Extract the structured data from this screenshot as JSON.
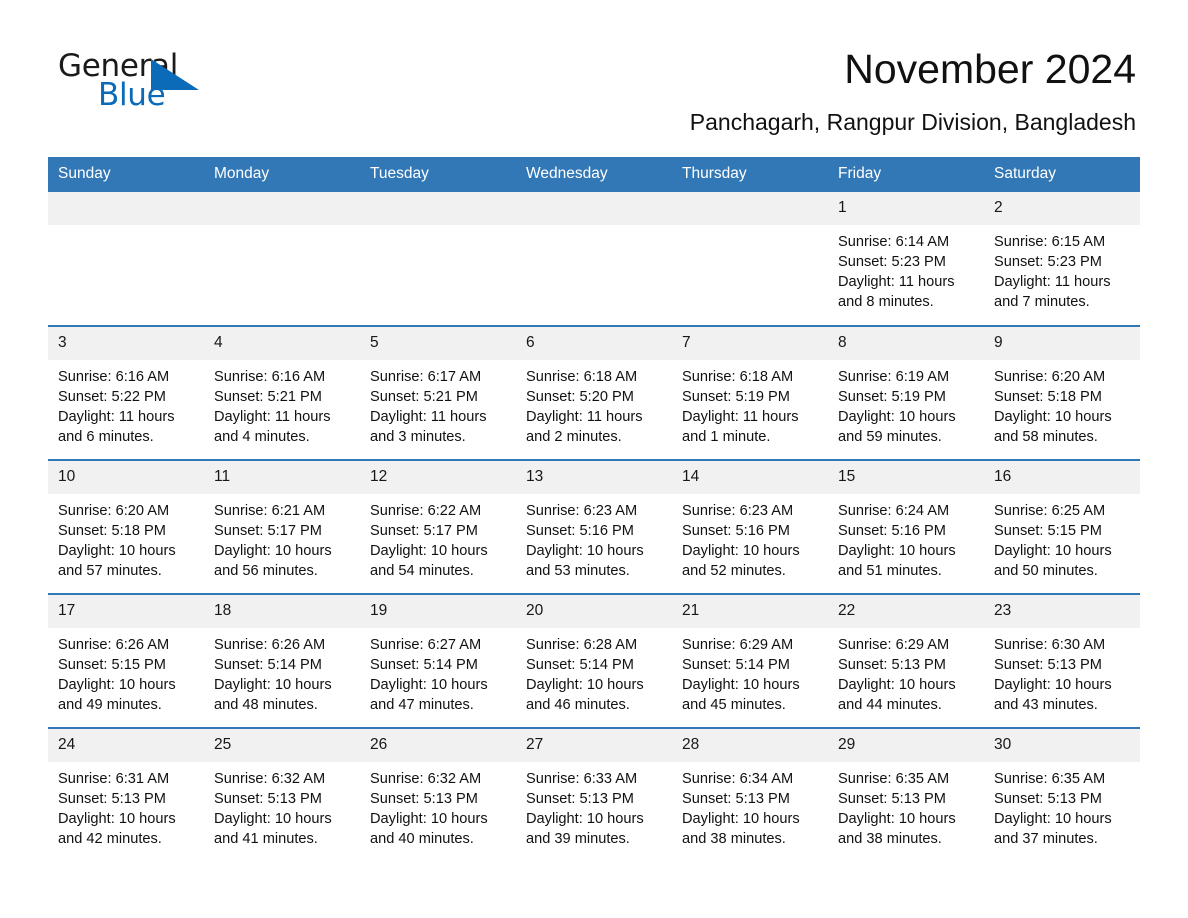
{
  "brand": {
    "word_one": "General",
    "word_two": "Blue",
    "flag_color": "#0b6bb8"
  },
  "header": {
    "month_title": "November 2024",
    "location": "Panchagarh, Rangpur Division, Bangladesh"
  },
  "theme": {
    "header_blue": "#3278b6",
    "daynum_gray": "#f1f1f1",
    "rule_blue": "#3278b6"
  },
  "calendar": {
    "weekday_headers": [
      "Sunday",
      "Monday",
      "Tuesday",
      "Wednesday",
      "Thursday",
      "Friday",
      "Saturday"
    ],
    "weeks": [
      [
        {
          "blank": true
        },
        {
          "blank": true
        },
        {
          "blank": true
        },
        {
          "blank": true
        },
        {
          "blank": true
        },
        {
          "day": "1",
          "sunrise": "Sunrise: 6:14 AM",
          "sunset": "Sunset: 5:23 PM",
          "daylight": "Daylight: 11 hours and 8 minutes."
        },
        {
          "day": "2",
          "sunrise": "Sunrise: 6:15 AM",
          "sunset": "Sunset: 5:23 PM",
          "daylight": "Daylight: 11 hours and 7 minutes."
        }
      ],
      [
        {
          "day": "3",
          "sunrise": "Sunrise: 6:16 AM",
          "sunset": "Sunset: 5:22 PM",
          "daylight": "Daylight: 11 hours and 6 minutes."
        },
        {
          "day": "4",
          "sunrise": "Sunrise: 6:16 AM",
          "sunset": "Sunset: 5:21 PM",
          "daylight": "Daylight: 11 hours and 4 minutes."
        },
        {
          "day": "5",
          "sunrise": "Sunrise: 6:17 AM",
          "sunset": "Sunset: 5:21 PM",
          "daylight": "Daylight: 11 hours and 3 minutes."
        },
        {
          "day": "6",
          "sunrise": "Sunrise: 6:18 AM",
          "sunset": "Sunset: 5:20 PM",
          "daylight": "Daylight: 11 hours and 2 minutes."
        },
        {
          "day": "7",
          "sunrise": "Sunrise: 6:18 AM",
          "sunset": "Sunset: 5:19 PM",
          "daylight": "Daylight: 11 hours and 1 minute."
        },
        {
          "day": "8",
          "sunrise": "Sunrise: 6:19 AM",
          "sunset": "Sunset: 5:19 PM",
          "daylight": "Daylight: 10 hours and 59 minutes."
        },
        {
          "day": "9",
          "sunrise": "Sunrise: 6:20 AM",
          "sunset": "Sunset: 5:18 PM",
          "daylight": "Daylight: 10 hours and 58 minutes."
        }
      ],
      [
        {
          "day": "10",
          "sunrise": "Sunrise: 6:20 AM",
          "sunset": "Sunset: 5:18 PM",
          "daylight": "Daylight: 10 hours and 57 minutes."
        },
        {
          "day": "11",
          "sunrise": "Sunrise: 6:21 AM",
          "sunset": "Sunset: 5:17 PM",
          "daylight": "Daylight: 10 hours and 56 minutes."
        },
        {
          "day": "12",
          "sunrise": "Sunrise: 6:22 AM",
          "sunset": "Sunset: 5:17 PM",
          "daylight": "Daylight: 10 hours and 54 minutes."
        },
        {
          "day": "13",
          "sunrise": "Sunrise: 6:23 AM",
          "sunset": "Sunset: 5:16 PM",
          "daylight": "Daylight: 10 hours and 53 minutes."
        },
        {
          "day": "14",
          "sunrise": "Sunrise: 6:23 AM",
          "sunset": "Sunset: 5:16 PM",
          "daylight": "Daylight: 10 hours and 52 minutes."
        },
        {
          "day": "15",
          "sunrise": "Sunrise: 6:24 AM",
          "sunset": "Sunset: 5:16 PM",
          "daylight": "Daylight: 10 hours and 51 minutes."
        },
        {
          "day": "16",
          "sunrise": "Sunrise: 6:25 AM",
          "sunset": "Sunset: 5:15 PM",
          "daylight": "Daylight: 10 hours and 50 minutes."
        }
      ],
      [
        {
          "day": "17",
          "sunrise": "Sunrise: 6:26 AM",
          "sunset": "Sunset: 5:15 PM",
          "daylight": "Daylight: 10 hours and 49 minutes."
        },
        {
          "day": "18",
          "sunrise": "Sunrise: 6:26 AM",
          "sunset": "Sunset: 5:14 PM",
          "daylight": "Daylight: 10 hours and 48 minutes."
        },
        {
          "day": "19",
          "sunrise": "Sunrise: 6:27 AM",
          "sunset": "Sunset: 5:14 PM",
          "daylight": "Daylight: 10 hours and 47 minutes."
        },
        {
          "day": "20",
          "sunrise": "Sunrise: 6:28 AM",
          "sunset": "Sunset: 5:14 PM",
          "daylight": "Daylight: 10 hours and 46 minutes."
        },
        {
          "day": "21",
          "sunrise": "Sunrise: 6:29 AM",
          "sunset": "Sunset: 5:14 PM",
          "daylight": "Daylight: 10 hours and 45 minutes."
        },
        {
          "day": "22",
          "sunrise": "Sunrise: 6:29 AM",
          "sunset": "Sunset: 5:13 PM",
          "daylight": "Daylight: 10 hours and 44 minutes."
        },
        {
          "day": "23",
          "sunrise": "Sunrise: 6:30 AM",
          "sunset": "Sunset: 5:13 PM",
          "daylight": "Daylight: 10 hours and 43 minutes."
        }
      ],
      [
        {
          "day": "24",
          "sunrise": "Sunrise: 6:31 AM",
          "sunset": "Sunset: 5:13 PM",
          "daylight": "Daylight: 10 hours and 42 minutes."
        },
        {
          "day": "25",
          "sunrise": "Sunrise: 6:32 AM",
          "sunset": "Sunset: 5:13 PM",
          "daylight": "Daylight: 10 hours and 41 minutes."
        },
        {
          "day": "26",
          "sunrise": "Sunrise: 6:32 AM",
          "sunset": "Sunset: 5:13 PM",
          "daylight": "Daylight: 10 hours and 40 minutes."
        },
        {
          "day": "27",
          "sunrise": "Sunrise: 6:33 AM",
          "sunset": "Sunset: 5:13 PM",
          "daylight": "Daylight: 10 hours and 39 minutes."
        },
        {
          "day": "28",
          "sunrise": "Sunrise: 6:34 AM",
          "sunset": "Sunset: 5:13 PM",
          "daylight": "Daylight: 10 hours and 38 minutes."
        },
        {
          "day": "29",
          "sunrise": "Sunrise: 6:35 AM",
          "sunset": "Sunset: 5:13 PM",
          "daylight": "Daylight: 10 hours and 38 minutes."
        },
        {
          "day": "30",
          "sunrise": "Sunrise: 6:35 AM",
          "sunset": "Sunset: 5:13 PM",
          "daylight": "Daylight: 10 hours and 37 minutes."
        }
      ]
    ]
  }
}
